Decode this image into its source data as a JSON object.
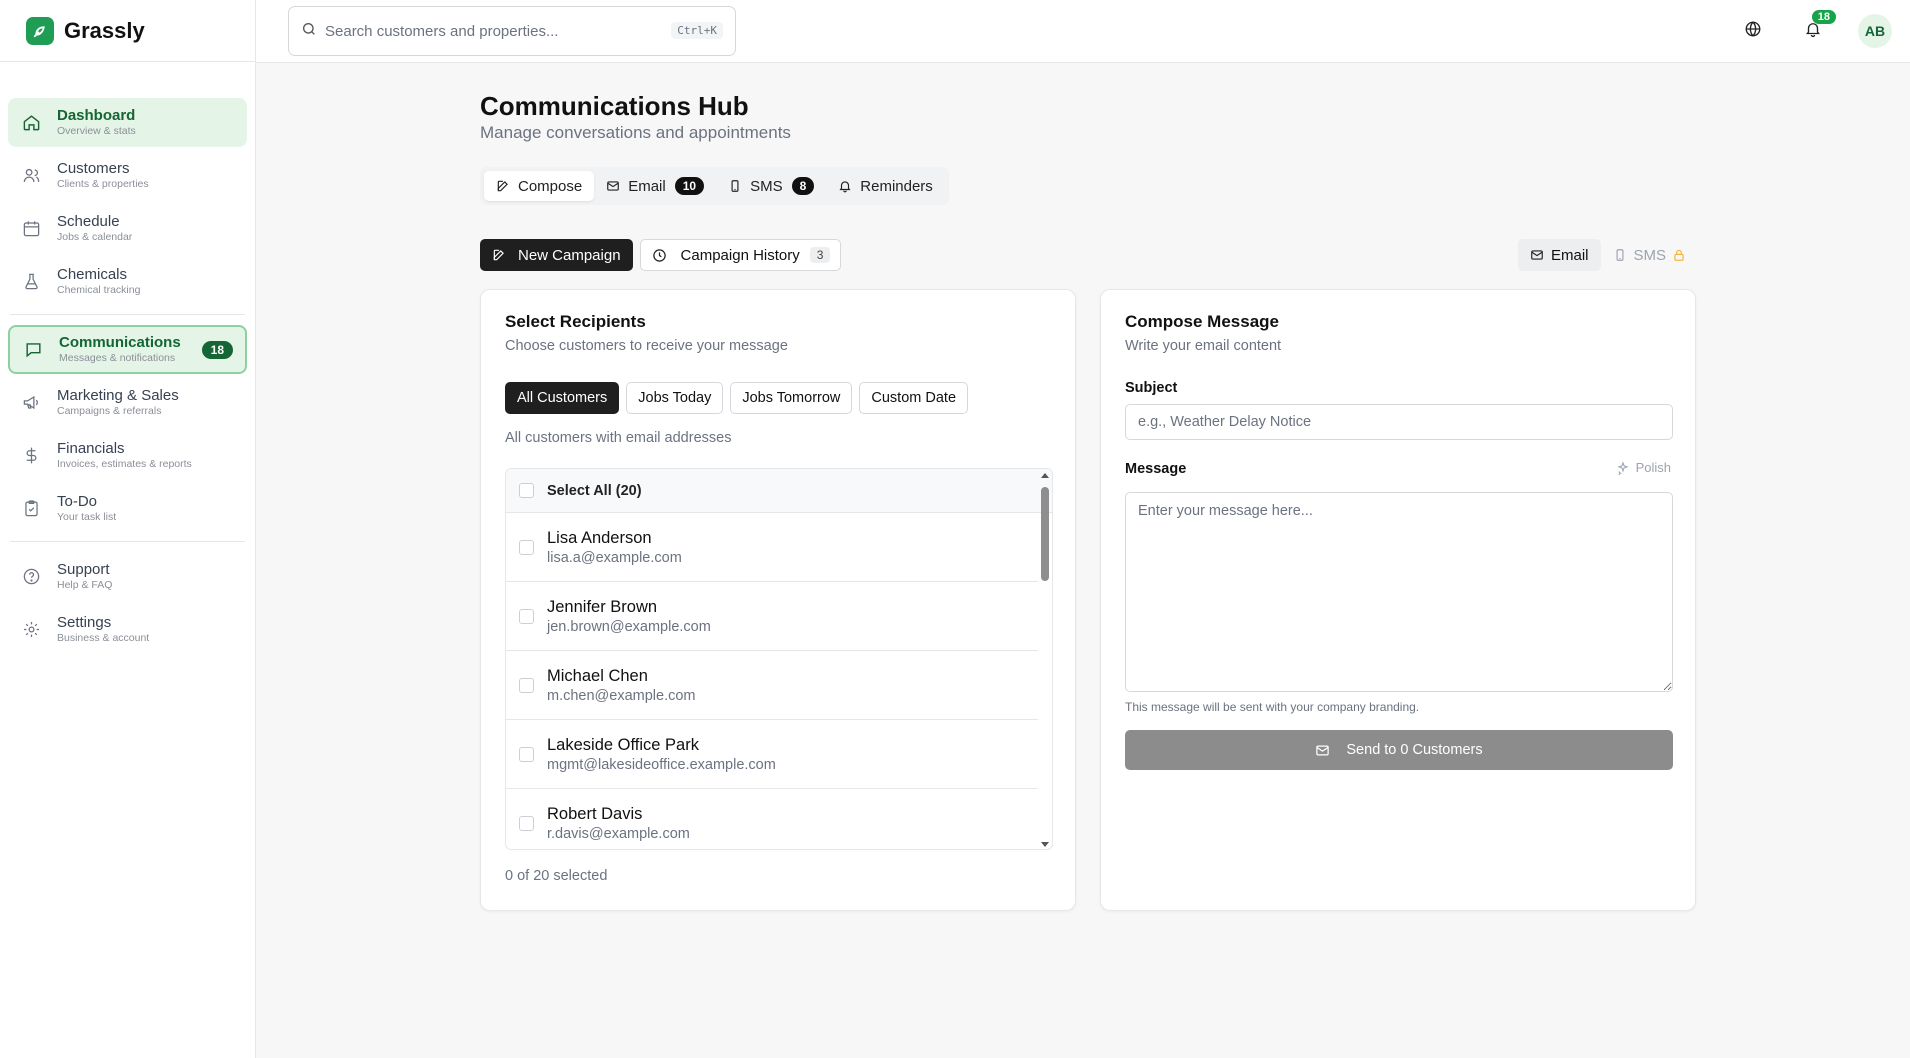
{
  "brand": {
    "name": "Grassly"
  },
  "colors": {
    "brand_green": "#1f9d55",
    "active_bg": "#e4f5e7",
    "active_text": "#166534",
    "dark_button": "#1f1f1f",
    "disabled_send": "#8c8c8c"
  },
  "search": {
    "placeholder": "Search customers and properties...",
    "shortcut": "Ctrl+K"
  },
  "topbar": {
    "notifications_count": "18",
    "avatar_initials": "AB",
    "icons": [
      "globe-icon",
      "bell-icon"
    ]
  },
  "sidebar": {
    "items": [
      {
        "label": "Dashboard",
        "sub": "Overview & stats",
        "icon": "home-icon"
      },
      {
        "label": "Customers",
        "sub": "Clients & properties",
        "icon": "users-icon"
      },
      {
        "label": "Schedule",
        "sub": "Jobs & calendar",
        "icon": "calendar-icon"
      },
      {
        "label": "Chemicals",
        "sub": "Chemical tracking",
        "icon": "flask-icon"
      },
      {
        "label": "Communications",
        "sub": "Messages & notifications",
        "icon": "message-icon",
        "badge": "18"
      },
      {
        "label": "Marketing & Sales",
        "sub": "Campaigns & referrals",
        "icon": "megaphone-icon"
      },
      {
        "label": "Financials",
        "sub": "Invoices, estimates & reports",
        "icon": "dollar-icon"
      },
      {
        "label": "To-Do",
        "sub": "Your task list",
        "icon": "clipboard-icon"
      },
      {
        "label": "Support",
        "sub": "Help & FAQ",
        "icon": "help-icon"
      },
      {
        "label": "Settings",
        "sub": "Business & account",
        "icon": "gear-icon"
      }
    ]
  },
  "page": {
    "title": "Communications Hub",
    "subtitle": "Manage conversations and appointments"
  },
  "tabs": [
    {
      "label": "Compose"
    },
    {
      "label": "Email",
      "badge": "10"
    },
    {
      "label": "SMS",
      "badge": "8"
    },
    {
      "label": "Reminders"
    }
  ],
  "campaign": {
    "new_label": "New Campaign",
    "history_label": "Campaign History",
    "history_count": "3"
  },
  "channel": {
    "email": "Email",
    "sms": "SMS"
  },
  "recipients": {
    "title": "Select Recipients",
    "subtitle": "Choose customers to receive your message",
    "filters": [
      "All Customers",
      "Jobs Today",
      "Jobs Tomorrow",
      "Custom Date"
    ],
    "filter_note": "All customers with email addresses",
    "select_all": "Select All (20)",
    "customers": [
      {
        "name": "Lisa Anderson",
        "email": "lisa.a@example.com"
      },
      {
        "name": "Jennifer Brown",
        "email": "jen.brown@example.com"
      },
      {
        "name": "Michael Chen",
        "email": "m.chen@example.com"
      },
      {
        "name": "Lakeside Office Park",
        "email": "mgmt@lakesideoffice.example.com"
      },
      {
        "name": "Robert Davis",
        "email": "r.davis@example.com"
      }
    ],
    "selected": "0 of 20 selected"
  },
  "compose": {
    "title": "Compose Message",
    "subtitle": "Write your email content",
    "subject_label": "Subject",
    "subject_placeholder": "e.g., Weather Delay Notice",
    "message_label": "Message",
    "polish_label": "Polish",
    "message_placeholder": "Enter your message here...",
    "branding_note": "This message will be sent with your company branding.",
    "send_label": "Send to 0 Customers"
  }
}
